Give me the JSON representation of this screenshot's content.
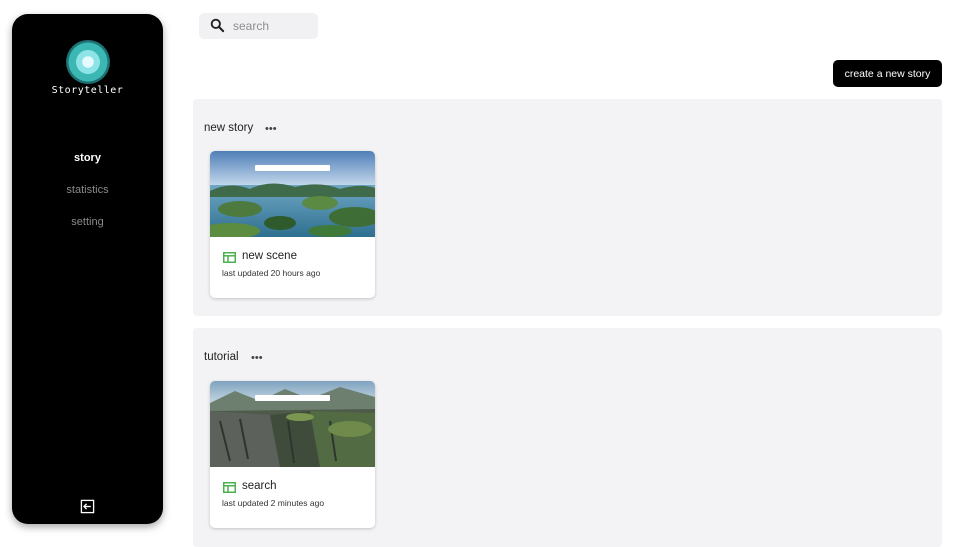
{
  "app": {
    "logo_text": "Storyteller"
  },
  "sidebar": {
    "items": [
      {
        "label": "story",
        "active": true
      },
      {
        "label": "statistics",
        "active": false
      },
      {
        "label": "setting",
        "active": false
      }
    ],
    "logout_icon": "logout-icon"
  },
  "search": {
    "placeholder": "search",
    "value": ""
  },
  "toolbar": {
    "create_label": "create a new story"
  },
  "groups": [
    {
      "title": "new story",
      "cards": [
        {
          "title": "new scene",
          "updated": "last updated 20 hours ago"
        }
      ]
    },
    {
      "title": "tutorial",
      "cards": [
        {
          "title": "search",
          "updated": "last updated 2 minutes ago"
        }
      ]
    }
  ],
  "colors": {
    "accent": "#000000",
    "scene_icon": "#4caf50",
    "group_bg": "#f3f3f5"
  }
}
